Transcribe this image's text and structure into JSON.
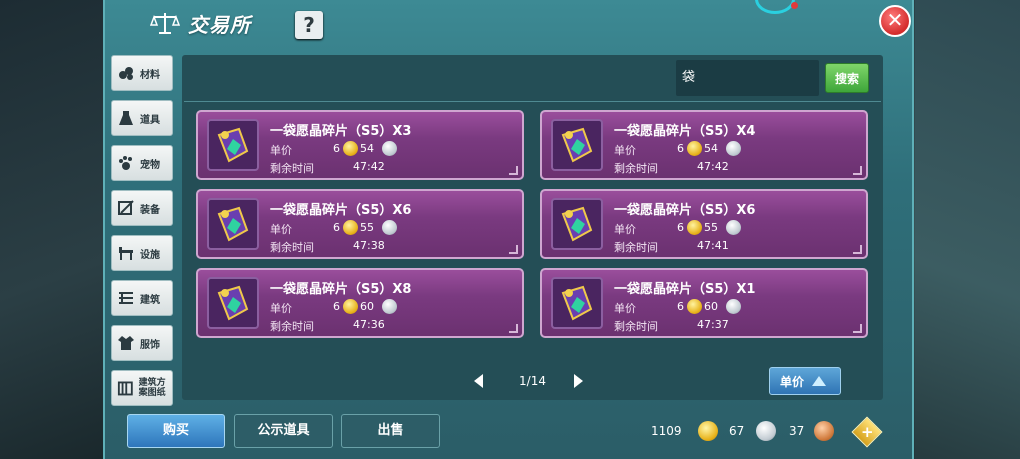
{
  "header": {
    "title": "交易所",
    "help_label": "?",
    "close_label": "✕"
  },
  "sidebar": {
    "items": [
      {
        "label": "材料",
        "icon": "materials-icon"
      },
      {
        "label": "道具",
        "icon": "item-icon"
      },
      {
        "label": "宠物",
        "icon": "pet-icon"
      },
      {
        "label": "装备",
        "icon": "equipment-icon"
      },
      {
        "label": "设施",
        "icon": "facility-icon"
      },
      {
        "label": "建筑",
        "icon": "building-icon"
      },
      {
        "label": "服饰",
        "icon": "clothing-icon"
      },
      {
        "label": "建筑方案图纸",
        "icon": "blueprint-icon"
      }
    ]
  },
  "search": {
    "value": "袋",
    "button_label": "搜索"
  },
  "listings": [
    {
      "name": "一袋愿晶碎片（S5）X3",
      "price_label": "单价",
      "gold": "6",
      "silver": "54",
      "time_label": "剩余时间",
      "time": "47:42"
    },
    {
      "name": "一袋愿晶碎片（S5）X4",
      "price_label": "单价",
      "gold": "6",
      "silver": "54",
      "time_label": "剩余时间",
      "time": "47:42"
    },
    {
      "name": "一袋愿晶碎片（S5）X6",
      "price_label": "单价",
      "gold": "6",
      "silver": "55",
      "time_label": "剩余时间",
      "time": "47:38"
    },
    {
      "name": "一袋愿晶碎片（S5）X6",
      "price_label": "单价",
      "gold": "6",
      "silver": "55",
      "time_label": "剩余时间",
      "time": "47:41"
    },
    {
      "name": "一袋愿晶碎片（S5）X8",
      "price_label": "单价",
      "gold": "6",
      "silver": "60",
      "time_label": "剩余时间",
      "time": "47:36"
    },
    {
      "name": "一袋愿晶碎片（S5）X1",
      "price_label": "单价",
      "gold": "6",
      "silver": "60",
      "time_label": "剩余时间",
      "time": "47:37"
    }
  ],
  "pager": {
    "text": "1/14"
  },
  "sort": {
    "label": "单价"
  },
  "actions": {
    "buy": "购买",
    "publish": "公示道具",
    "sell": "出售"
  },
  "currency": {
    "gold": "1109",
    "silver": "67",
    "copper": "37"
  },
  "colors": {
    "card": "#7a3a80",
    "panel": "#2f6f7a",
    "search_button": "#3ea63a",
    "buy_button": "#2e76bb"
  }
}
